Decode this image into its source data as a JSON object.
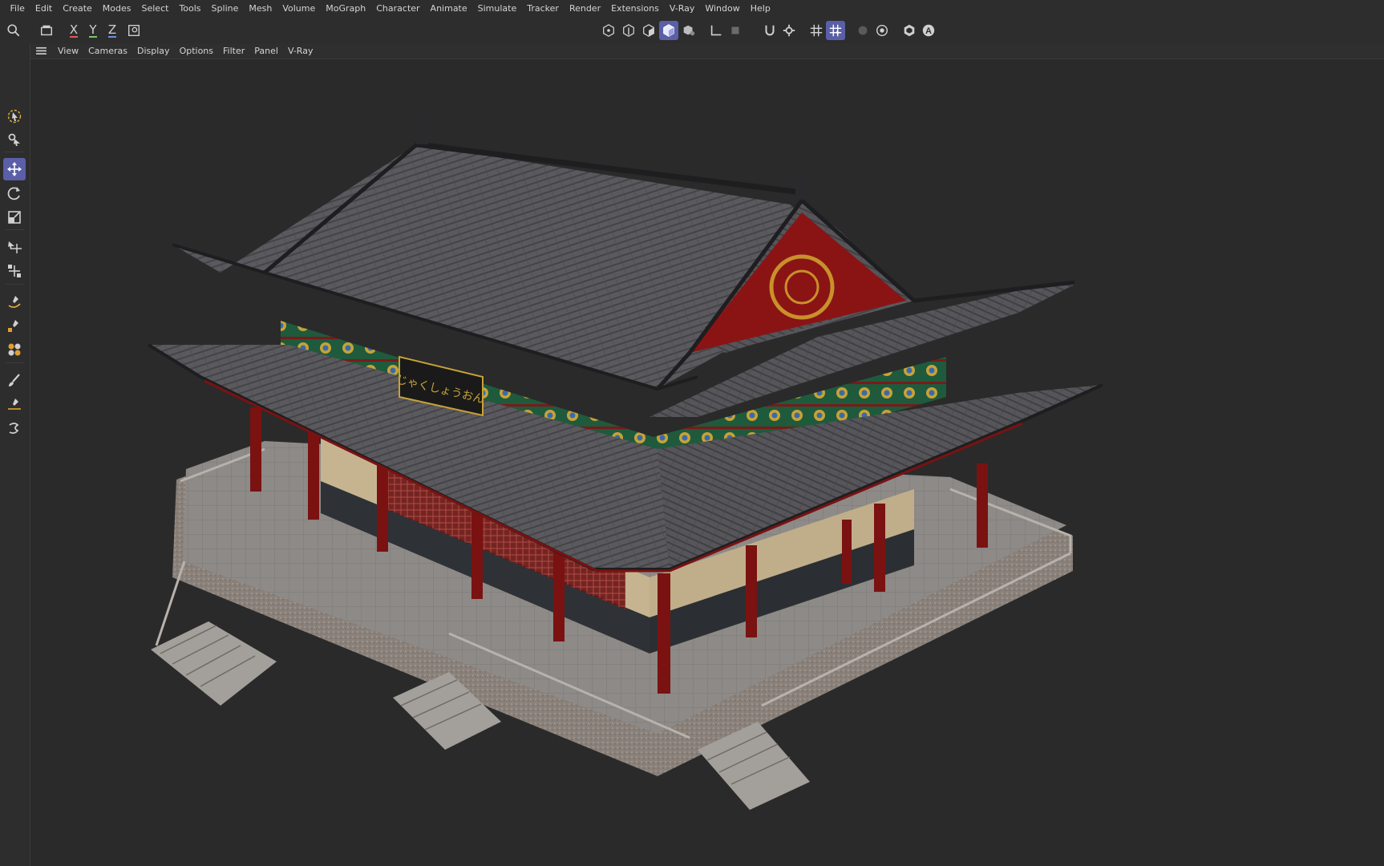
{
  "menubar": {
    "items": [
      "File",
      "Edit",
      "Create",
      "Modes",
      "Select",
      "Tools",
      "Spline",
      "Mesh",
      "Volume",
      "MoGraph",
      "Character",
      "Animate",
      "Simulate",
      "Tracker",
      "Render",
      "Extensions",
      "V-Ray",
      "Window",
      "Help"
    ]
  },
  "toolbar": {
    "axis_x": "X",
    "axis_y": "Y",
    "axis_z": "Z"
  },
  "viewport_menu": {
    "items": [
      "View",
      "Cameras",
      "Display",
      "Options",
      "Filter",
      "Panel",
      "V-Ray"
    ]
  },
  "scene": {
    "plaque_text": "じゃくしょうおん"
  },
  "colors": {
    "accent": "#5a5fa8",
    "axis_x": "#e05a5a",
    "axis_y": "#7ac46a",
    "axis_z": "#6a8fe0"
  }
}
